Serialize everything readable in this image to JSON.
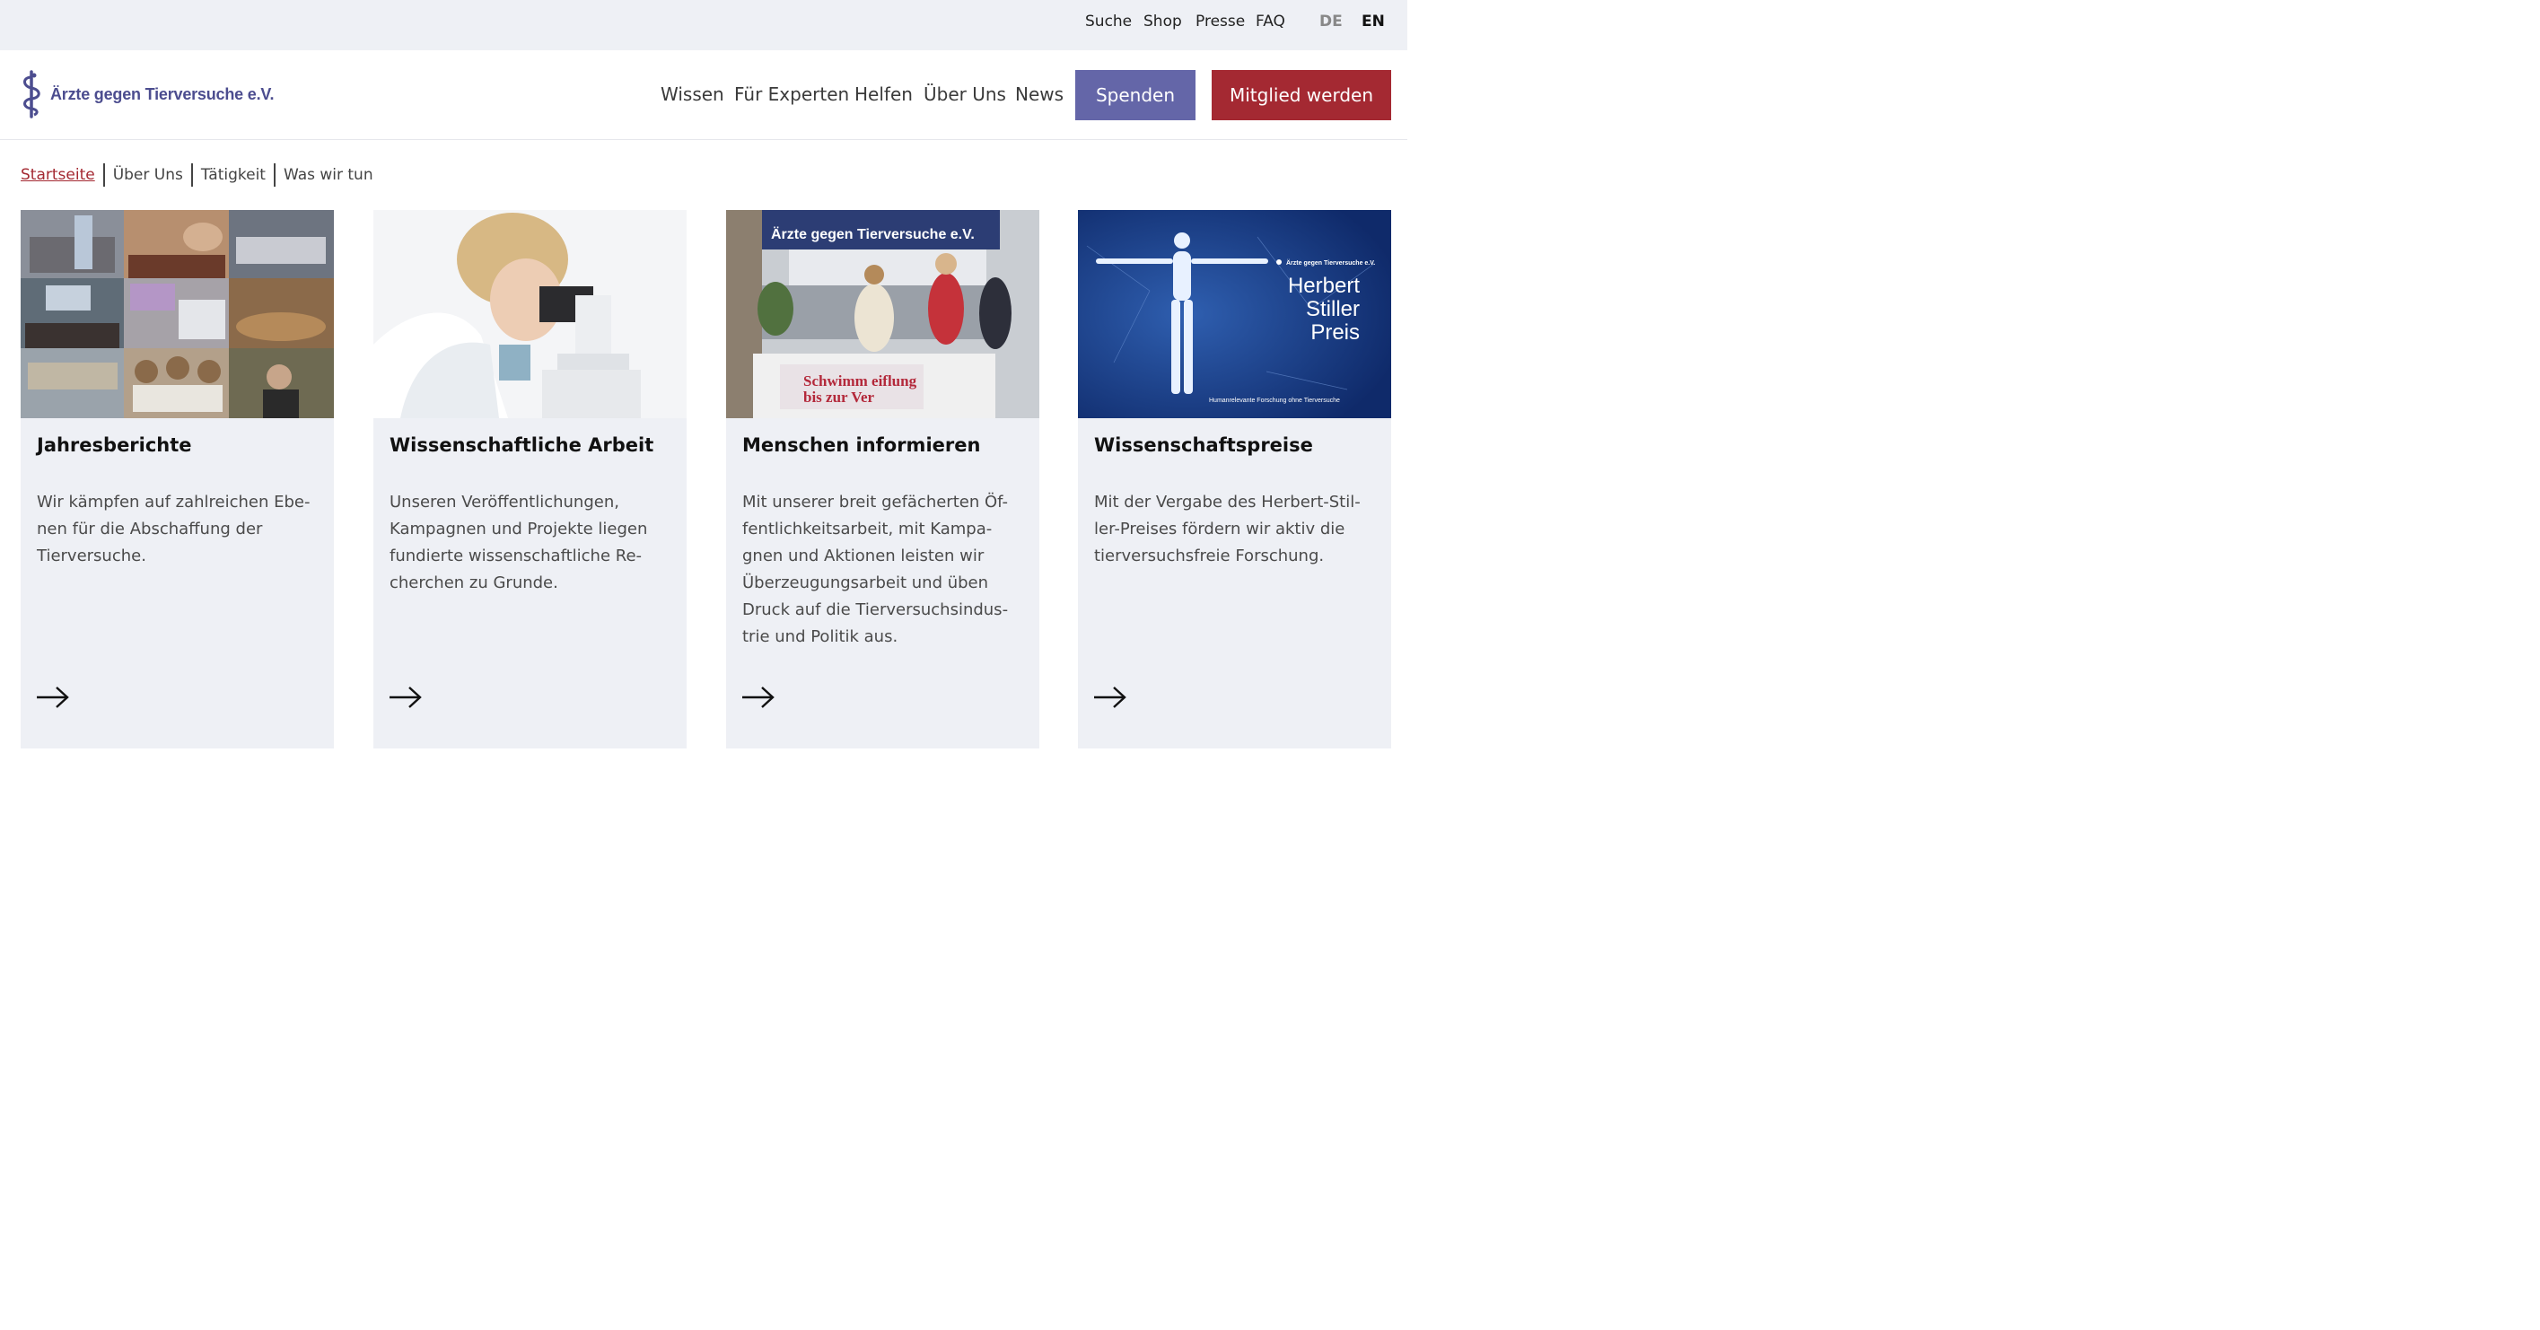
{
  "topbar": {
    "links": [
      "Suche",
      "Shop",
      "Presse",
      "FAQ"
    ],
    "lang_de": "DE",
    "lang_en": "EN"
  },
  "header": {
    "logo_text": "Ärzte gegen Tierversuche e.V.",
    "nav": [
      "Wissen",
      "Für Experten",
      "Helfen",
      "Über Uns",
      "News"
    ],
    "donate_label": "Spenden",
    "member_label": "Mitglied werden",
    "colors": {
      "brand": "#4c4d8f",
      "donate": "#6466a8",
      "member": "#a42932"
    }
  },
  "breadcrumb": [
    "Startseite",
    "Über Uns",
    "Tätigkeit",
    "Was wir tun"
  ],
  "cards": [
    {
      "title": "Jahresberichte",
      "desc": "Wir kämpfen auf zahlreichen Ebe-nen für die Abschaffung der Tierversuche."
    },
    {
      "title": "Wissenschaftliche Arbeit",
      "desc": "Unseren Veröffentlichungen, Kampagnen und Projekte liegen fundierte wissenschaftliche Re-cherchen zu Grunde."
    },
    {
      "title": "Menschen informieren",
      "desc": "Mit unserer breit gefächerten Öf-fentlichkeitsarbeit, mit Kampa-gnen und Aktionen leisten wir Überzeugungsarbeit und üben Druck auf die Tierversuchsindus-trie und Politik aus.",
      "photo_texts": {
        "tent_banner": "Ärzte gegen Tierversuche e.V.",
        "table_banner_1": "Schwimm  eiflung",
        "table_banner_2": "bis zur Ver"
      }
    },
    {
      "title": "Wissenschaftspreise",
      "desc": "Mit der Vergabe des Herbert-Stil-ler-Preises fördern wir aktiv die tierversuchsfreie Forschung.",
      "poster": {
        "org": "Ärzte gegen Tierversuche e.V.",
        "line1": "Herbert",
        "line2": "Stiller",
        "line3": "Preis",
        "tagline": "Humanrelevante Forschung ohne Tierversuche"
      }
    }
  ],
  "icons": [
    "staff-logo-icon",
    "arrow-right-icon"
  ]
}
